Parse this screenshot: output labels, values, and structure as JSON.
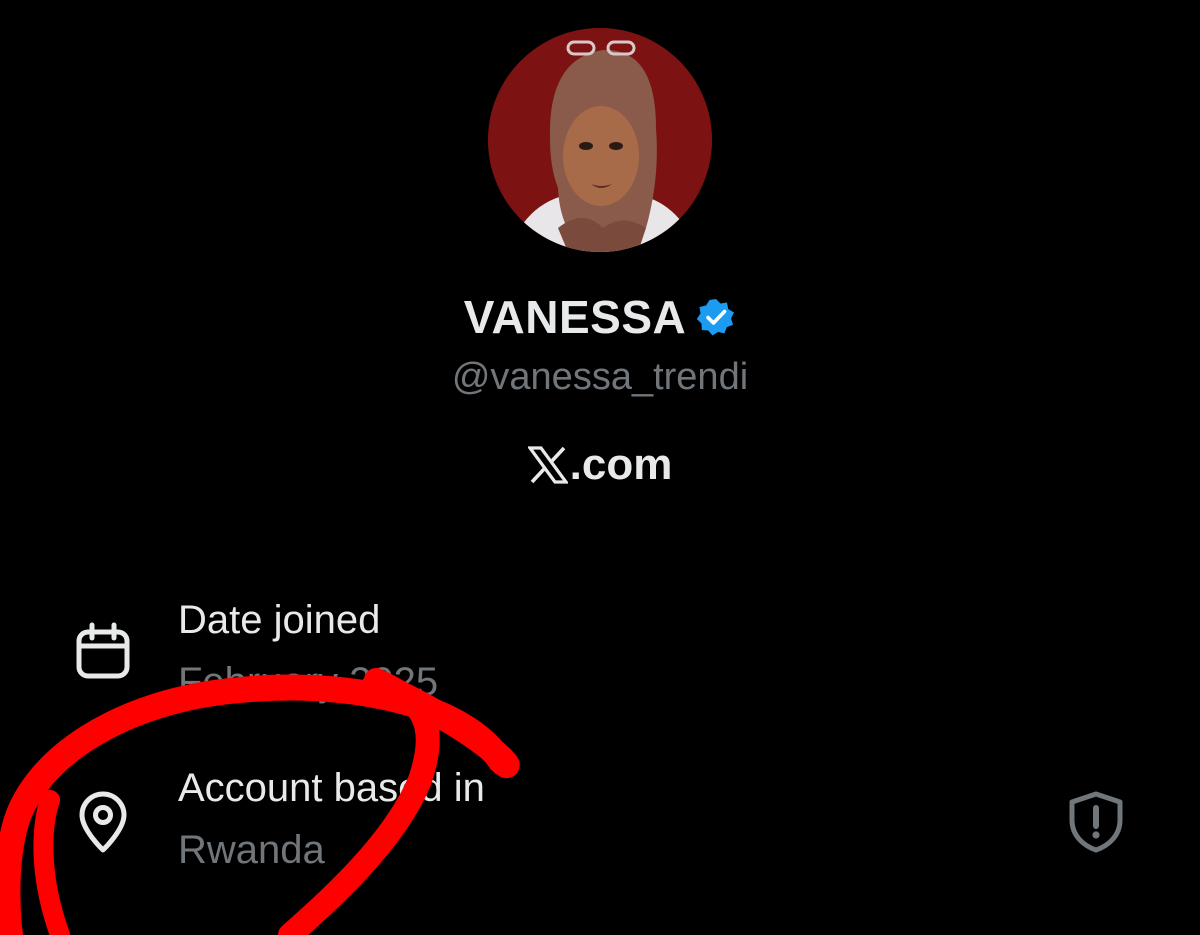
{
  "profile": {
    "display_name": "VANESSA",
    "verified": true,
    "handle": "@vanessa_trendi",
    "avatar_icon": "profile-photo"
  },
  "site": {
    "logo_icon": "x-logo-icon",
    "label": ".com"
  },
  "info": {
    "date_joined": {
      "title": "Date joined",
      "value": "February 2025",
      "icon": "calendar-icon"
    },
    "location": {
      "title": "Account based in",
      "value": "Rwanda",
      "icon": "location-pin-icon",
      "action_icon": "shield-alert-icon"
    }
  },
  "colors": {
    "background": "#000000",
    "primary_text": "#e7e9ea",
    "secondary_text": "#71767b",
    "verified_badge": "#1d9bf0",
    "annotation": "#ff0000"
  }
}
